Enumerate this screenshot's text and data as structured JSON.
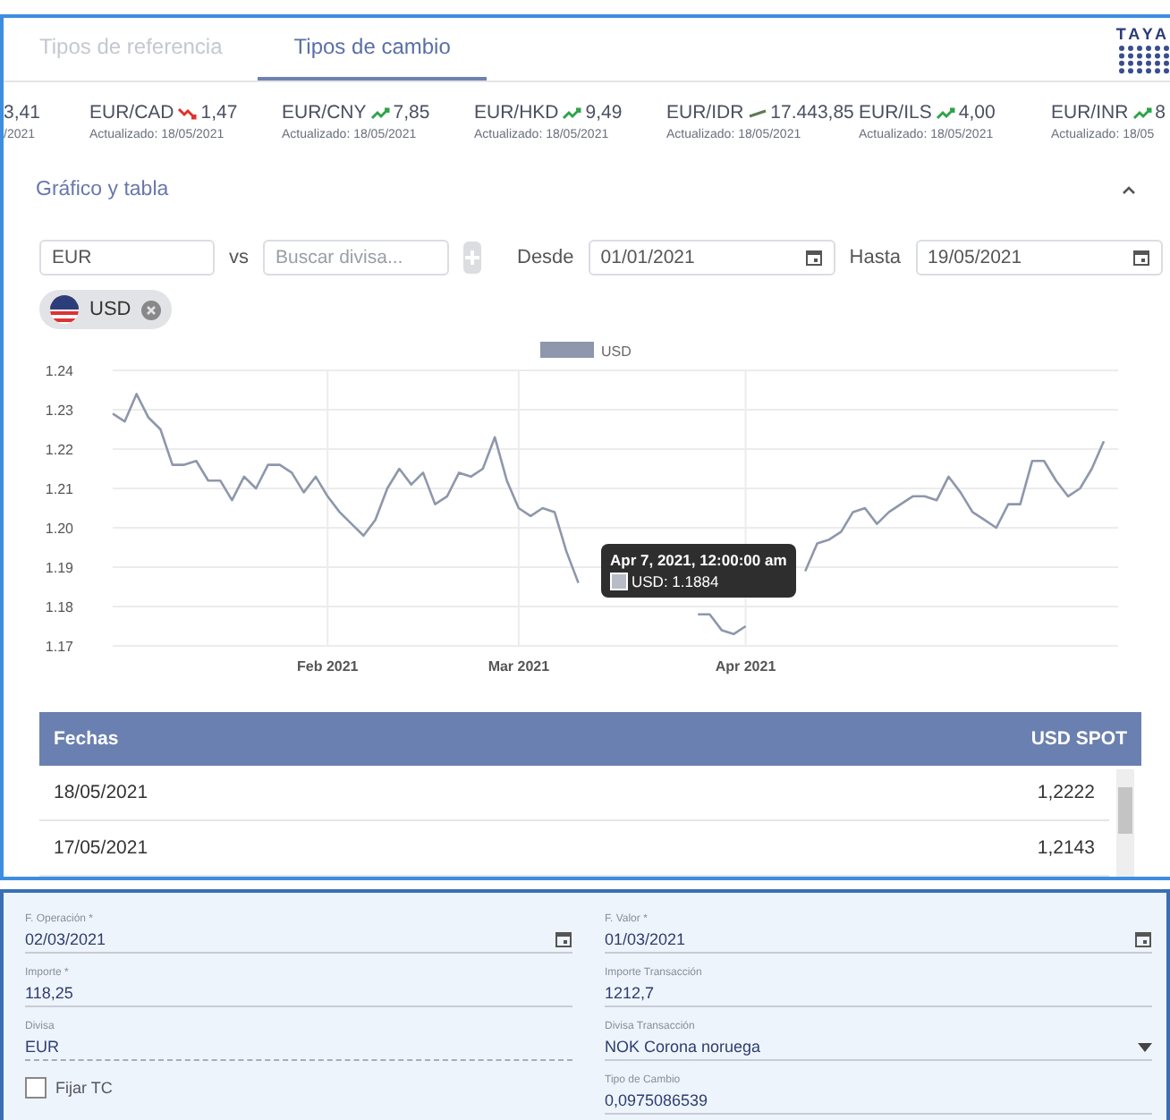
{
  "tabs": [
    {
      "label": "Tipos de referencia",
      "selected": false
    },
    {
      "label": "Tipos de cambio",
      "selected": true
    }
  ],
  "logo": {
    "text": "TAYA"
  },
  "tickers": [
    {
      "value": "3,41",
      "updated": "/2021"
    },
    {
      "pair": "EUR/CAD",
      "kind": "down",
      "value": "1,47",
      "updated": "Actualizado: 18/05/2021"
    },
    {
      "pair": "EUR/CNY",
      "kind": "up",
      "value": "7,85",
      "updated": "Actualizado: 18/05/2021"
    },
    {
      "pair": "EUR/HKD",
      "kind": "up",
      "value": "9,49",
      "updated": "Actualizado: 18/05/2021"
    },
    {
      "pair": "EUR/IDR",
      "kind": "flat",
      "value": "17.443,85",
      "updated": "Actualizado: 18/05/2021"
    },
    {
      "pair": "EUR/ILS",
      "kind": "up",
      "value": "4,00",
      "updated": "Actualizado: 18/05/2021"
    },
    {
      "pair": "EUR/INR",
      "kind": "up",
      "value": "8",
      "updated": "Actualizado: 18/05"
    }
  ],
  "section": {
    "title": "Gráfico y tabla",
    "expanded": true
  },
  "filters": {
    "base": "EUR",
    "vs": "vs",
    "search_placeholder": "Buscar divisa...",
    "add_disabled": true,
    "from_label": "Desde",
    "from": "01/01/2021",
    "to_label": "Hasta",
    "to": "19/05/2021"
  },
  "chips": [
    {
      "label": "USD"
    }
  ],
  "chart": {
    "chart_data": {
      "type": "line",
      "grid": true,
      "ylim": [
        1.17,
        1.24
      ],
      "yticks": [
        {
          "value": 1.17,
          "label": "1.17"
        },
        {
          "value": 1.18,
          "label": "1.18"
        },
        {
          "value": 1.19,
          "label": "1.19"
        },
        {
          "value": 1.2,
          "label": "1.20"
        },
        {
          "value": 1.21,
          "label": "1.21"
        },
        {
          "value": 1.22,
          "label": "1.22"
        },
        {
          "value": 1.23,
          "label": "1.23"
        },
        {
          "value": 1.24,
          "label": "1.24"
        }
      ],
      "categories": [
        null,
        null,
        null,
        null,
        null,
        null,
        null,
        null,
        null,
        null,
        null,
        null,
        null,
        null,
        null,
        null,
        null,
        null,
        "Feb 2021",
        null,
        null,
        null,
        null,
        null,
        null,
        null,
        null,
        null,
        null,
        null,
        null,
        null,
        null,
        null,
        "Mar 2021",
        null,
        null,
        null,
        null,
        null,
        null,
        null,
        null,
        null,
        null,
        null,
        null,
        null,
        null,
        null,
        null,
        null,
        null,
        "Apr 2021",
        null,
        null,
        null,
        null,
        null,
        null,
        null,
        null,
        null,
        null,
        null,
        null,
        null,
        null,
        null,
        null,
        null,
        null,
        null,
        null,
        null,
        null,
        null,
        null,
        null,
        null,
        null,
        null,
        null,
        null
      ],
      "series": [
        {
          "name": "USD",
          "color": "#8e97ab",
          "values": [
            1.229,
            1.227,
            1.234,
            1.228,
            1.225,
            1.216,
            1.216,
            1.217,
            1.212,
            1.212,
            1.207,
            1.213,
            1.21,
            1.216,
            1.216,
            1.214,
            1.209,
            1.213,
            1.208,
            1.204,
            1.201,
            1.198,
            1.202,
            1.21,
            1.215,
            1.211,
            1.214,
            1.206,
            1.208,
            1.214,
            1.213,
            1.215,
            1.223,
            1.212,
            1.205,
            1.203,
            1.205,
            1.204,
            1.194,
            1.186,
            null,
            null,
            null,
            null,
            null,
            null,
            null,
            null,
            null,
            1.178,
            1.178,
            1.174,
            1.173,
            1.175,
            null,
            null,
            null,
            null,
            1.189,
            1.196,
            1.197,
            1.199,
            1.204,
            1.205,
            1.201,
            1.204,
            1.206,
            1.208,
            1.208,
            1.207,
            1.213,
            1.209,
            1.204,
            1.202,
            1.2,
            1.206,
            1.206,
            1.217,
            1.217,
            1.212,
            1.208,
            1.21,
            1.215,
            1.222
          ]
        }
      ]
    },
    "tooltip": {
      "title": "Apr 7, 2021, 12:00:00 am",
      "label": "USD: 1.1884"
    }
  },
  "table": {
    "columns": [
      "Fechas",
      "USD SPOT"
    ],
    "rows": [
      [
        "18/05/2021",
        "1,2222"
      ],
      [
        "17/05/2021",
        "1,2143"
      ]
    ]
  },
  "form": {
    "fields": [
      {
        "kind": "date",
        "label": "F. Operación *",
        "value": "02/03/2021"
      },
      {
        "kind": "date",
        "label": "F. Valor *",
        "value": "01/03/2021"
      },
      {
        "kind": "text",
        "label": "Importe *",
        "value": "118,25"
      },
      {
        "kind": "text",
        "label": "Importe Transacción",
        "value": "1212,7"
      },
      {
        "kind": "readonly",
        "label": "Divisa",
        "value": "EUR"
      },
      {
        "kind": "select",
        "label": "Divisa Transacción",
        "value": "NOK Corona noruega"
      },
      {
        "kind": "checkbox",
        "label": "Fijar TC",
        "checked": false
      },
      {
        "kind": "text",
        "label": "Tipo de Cambio",
        "value": "0,0975086539"
      }
    ]
  }
}
